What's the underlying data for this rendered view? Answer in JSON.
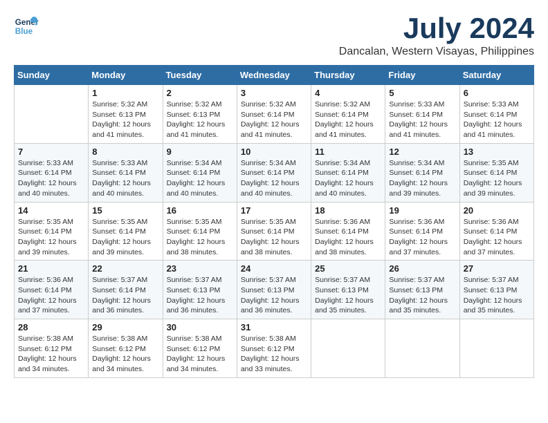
{
  "logo": {
    "line1": "General",
    "line2": "Blue"
  },
  "title": "July 2024",
  "location": "Dancalan, Western Visayas, Philippines",
  "days": [
    "Sunday",
    "Monday",
    "Tuesday",
    "Wednesday",
    "Thursday",
    "Friday",
    "Saturday"
  ],
  "weeks": [
    [
      {
        "day": "",
        "sunrise": "",
        "sunset": "",
        "daylight": ""
      },
      {
        "day": "1",
        "sunrise": "Sunrise: 5:32 AM",
        "sunset": "Sunset: 6:13 PM",
        "daylight": "Daylight: 12 hours and 41 minutes."
      },
      {
        "day": "2",
        "sunrise": "Sunrise: 5:32 AM",
        "sunset": "Sunset: 6:13 PM",
        "daylight": "Daylight: 12 hours and 41 minutes."
      },
      {
        "day": "3",
        "sunrise": "Sunrise: 5:32 AM",
        "sunset": "Sunset: 6:14 PM",
        "daylight": "Daylight: 12 hours and 41 minutes."
      },
      {
        "day": "4",
        "sunrise": "Sunrise: 5:32 AM",
        "sunset": "Sunset: 6:14 PM",
        "daylight": "Daylight: 12 hours and 41 minutes."
      },
      {
        "day": "5",
        "sunrise": "Sunrise: 5:33 AM",
        "sunset": "Sunset: 6:14 PM",
        "daylight": "Daylight: 12 hours and 41 minutes."
      },
      {
        "day": "6",
        "sunrise": "Sunrise: 5:33 AM",
        "sunset": "Sunset: 6:14 PM",
        "daylight": "Daylight: 12 hours and 41 minutes."
      }
    ],
    [
      {
        "day": "7",
        "sunrise": "Sunrise: 5:33 AM",
        "sunset": "Sunset: 6:14 PM",
        "daylight": "Daylight: 12 hours and 40 minutes."
      },
      {
        "day": "8",
        "sunrise": "Sunrise: 5:33 AM",
        "sunset": "Sunset: 6:14 PM",
        "daylight": "Daylight: 12 hours and 40 minutes."
      },
      {
        "day": "9",
        "sunrise": "Sunrise: 5:34 AM",
        "sunset": "Sunset: 6:14 PM",
        "daylight": "Daylight: 12 hours and 40 minutes."
      },
      {
        "day": "10",
        "sunrise": "Sunrise: 5:34 AM",
        "sunset": "Sunset: 6:14 PM",
        "daylight": "Daylight: 12 hours and 40 minutes."
      },
      {
        "day": "11",
        "sunrise": "Sunrise: 5:34 AM",
        "sunset": "Sunset: 6:14 PM",
        "daylight": "Daylight: 12 hours and 40 minutes."
      },
      {
        "day": "12",
        "sunrise": "Sunrise: 5:34 AM",
        "sunset": "Sunset: 6:14 PM",
        "daylight": "Daylight: 12 hours and 39 minutes."
      },
      {
        "day": "13",
        "sunrise": "Sunrise: 5:35 AM",
        "sunset": "Sunset: 6:14 PM",
        "daylight": "Daylight: 12 hours and 39 minutes."
      }
    ],
    [
      {
        "day": "14",
        "sunrise": "Sunrise: 5:35 AM",
        "sunset": "Sunset: 6:14 PM",
        "daylight": "Daylight: 12 hours and 39 minutes."
      },
      {
        "day": "15",
        "sunrise": "Sunrise: 5:35 AM",
        "sunset": "Sunset: 6:14 PM",
        "daylight": "Daylight: 12 hours and 39 minutes."
      },
      {
        "day": "16",
        "sunrise": "Sunrise: 5:35 AM",
        "sunset": "Sunset: 6:14 PM",
        "daylight": "Daylight: 12 hours and 38 minutes."
      },
      {
        "day": "17",
        "sunrise": "Sunrise: 5:35 AM",
        "sunset": "Sunset: 6:14 PM",
        "daylight": "Daylight: 12 hours and 38 minutes."
      },
      {
        "day": "18",
        "sunrise": "Sunrise: 5:36 AM",
        "sunset": "Sunset: 6:14 PM",
        "daylight": "Daylight: 12 hours and 38 minutes."
      },
      {
        "day": "19",
        "sunrise": "Sunrise: 5:36 AM",
        "sunset": "Sunset: 6:14 PM",
        "daylight": "Daylight: 12 hours and 37 minutes."
      },
      {
        "day": "20",
        "sunrise": "Sunrise: 5:36 AM",
        "sunset": "Sunset: 6:14 PM",
        "daylight": "Daylight: 12 hours and 37 minutes."
      }
    ],
    [
      {
        "day": "21",
        "sunrise": "Sunrise: 5:36 AM",
        "sunset": "Sunset: 6:14 PM",
        "daylight": "Daylight: 12 hours and 37 minutes."
      },
      {
        "day": "22",
        "sunrise": "Sunrise: 5:37 AM",
        "sunset": "Sunset: 6:14 PM",
        "daylight": "Daylight: 12 hours and 36 minutes."
      },
      {
        "day": "23",
        "sunrise": "Sunrise: 5:37 AM",
        "sunset": "Sunset: 6:13 PM",
        "daylight": "Daylight: 12 hours and 36 minutes."
      },
      {
        "day": "24",
        "sunrise": "Sunrise: 5:37 AM",
        "sunset": "Sunset: 6:13 PM",
        "daylight": "Daylight: 12 hours and 36 minutes."
      },
      {
        "day": "25",
        "sunrise": "Sunrise: 5:37 AM",
        "sunset": "Sunset: 6:13 PM",
        "daylight": "Daylight: 12 hours and 35 minutes."
      },
      {
        "day": "26",
        "sunrise": "Sunrise: 5:37 AM",
        "sunset": "Sunset: 6:13 PM",
        "daylight": "Daylight: 12 hours and 35 minutes."
      },
      {
        "day": "27",
        "sunrise": "Sunrise: 5:37 AM",
        "sunset": "Sunset: 6:13 PM",
        "daylight": "Daylight: 12 hours and 35 minutes."
      }
    ],
    [
      {
        "day": "28",
        "sunrise": "Sunrise: 5:38 AM",
        "sunset": "Sunset: 6:12 PM",
        "daylight": "Daylight: 12 hours and 34 minutes."
      },
      {
        "day": "29",
        "sunrise": "Sunrise: 5:38 AM",
        "sunset": "Sunset: 6:12 PM",
        "daylight": "Daylight: 12 hours and 34 minutes."
      },
      {
        "day": "30",
        "sunrise": "Sunrise: 5:38 AM",
        "sunset": "Sunset: 6:12 PM",
        "daylight": "Daylight: 12 hours and 34 minutes."
      },
      {
        "day": "31",
        "sunrise": "Sunrise: 5:38 AM",
        "sunset": "Sunset: 6:12 PM",
        "daylight": "Daylight: 12 hours and 33 minutes."
      },
      {
        "day": "",
        "sunrise": "",
        "sunset": "",
        "daylight": ""
      },
      {
        "day": "",
        "sunrise": "",
        "sunset": "",
        "daylight": ""
      },
      {
        "day": "",
        "sunrise": "",
        "sunset": "",
        "daylight": ""
      }
    ]
  ]
}
